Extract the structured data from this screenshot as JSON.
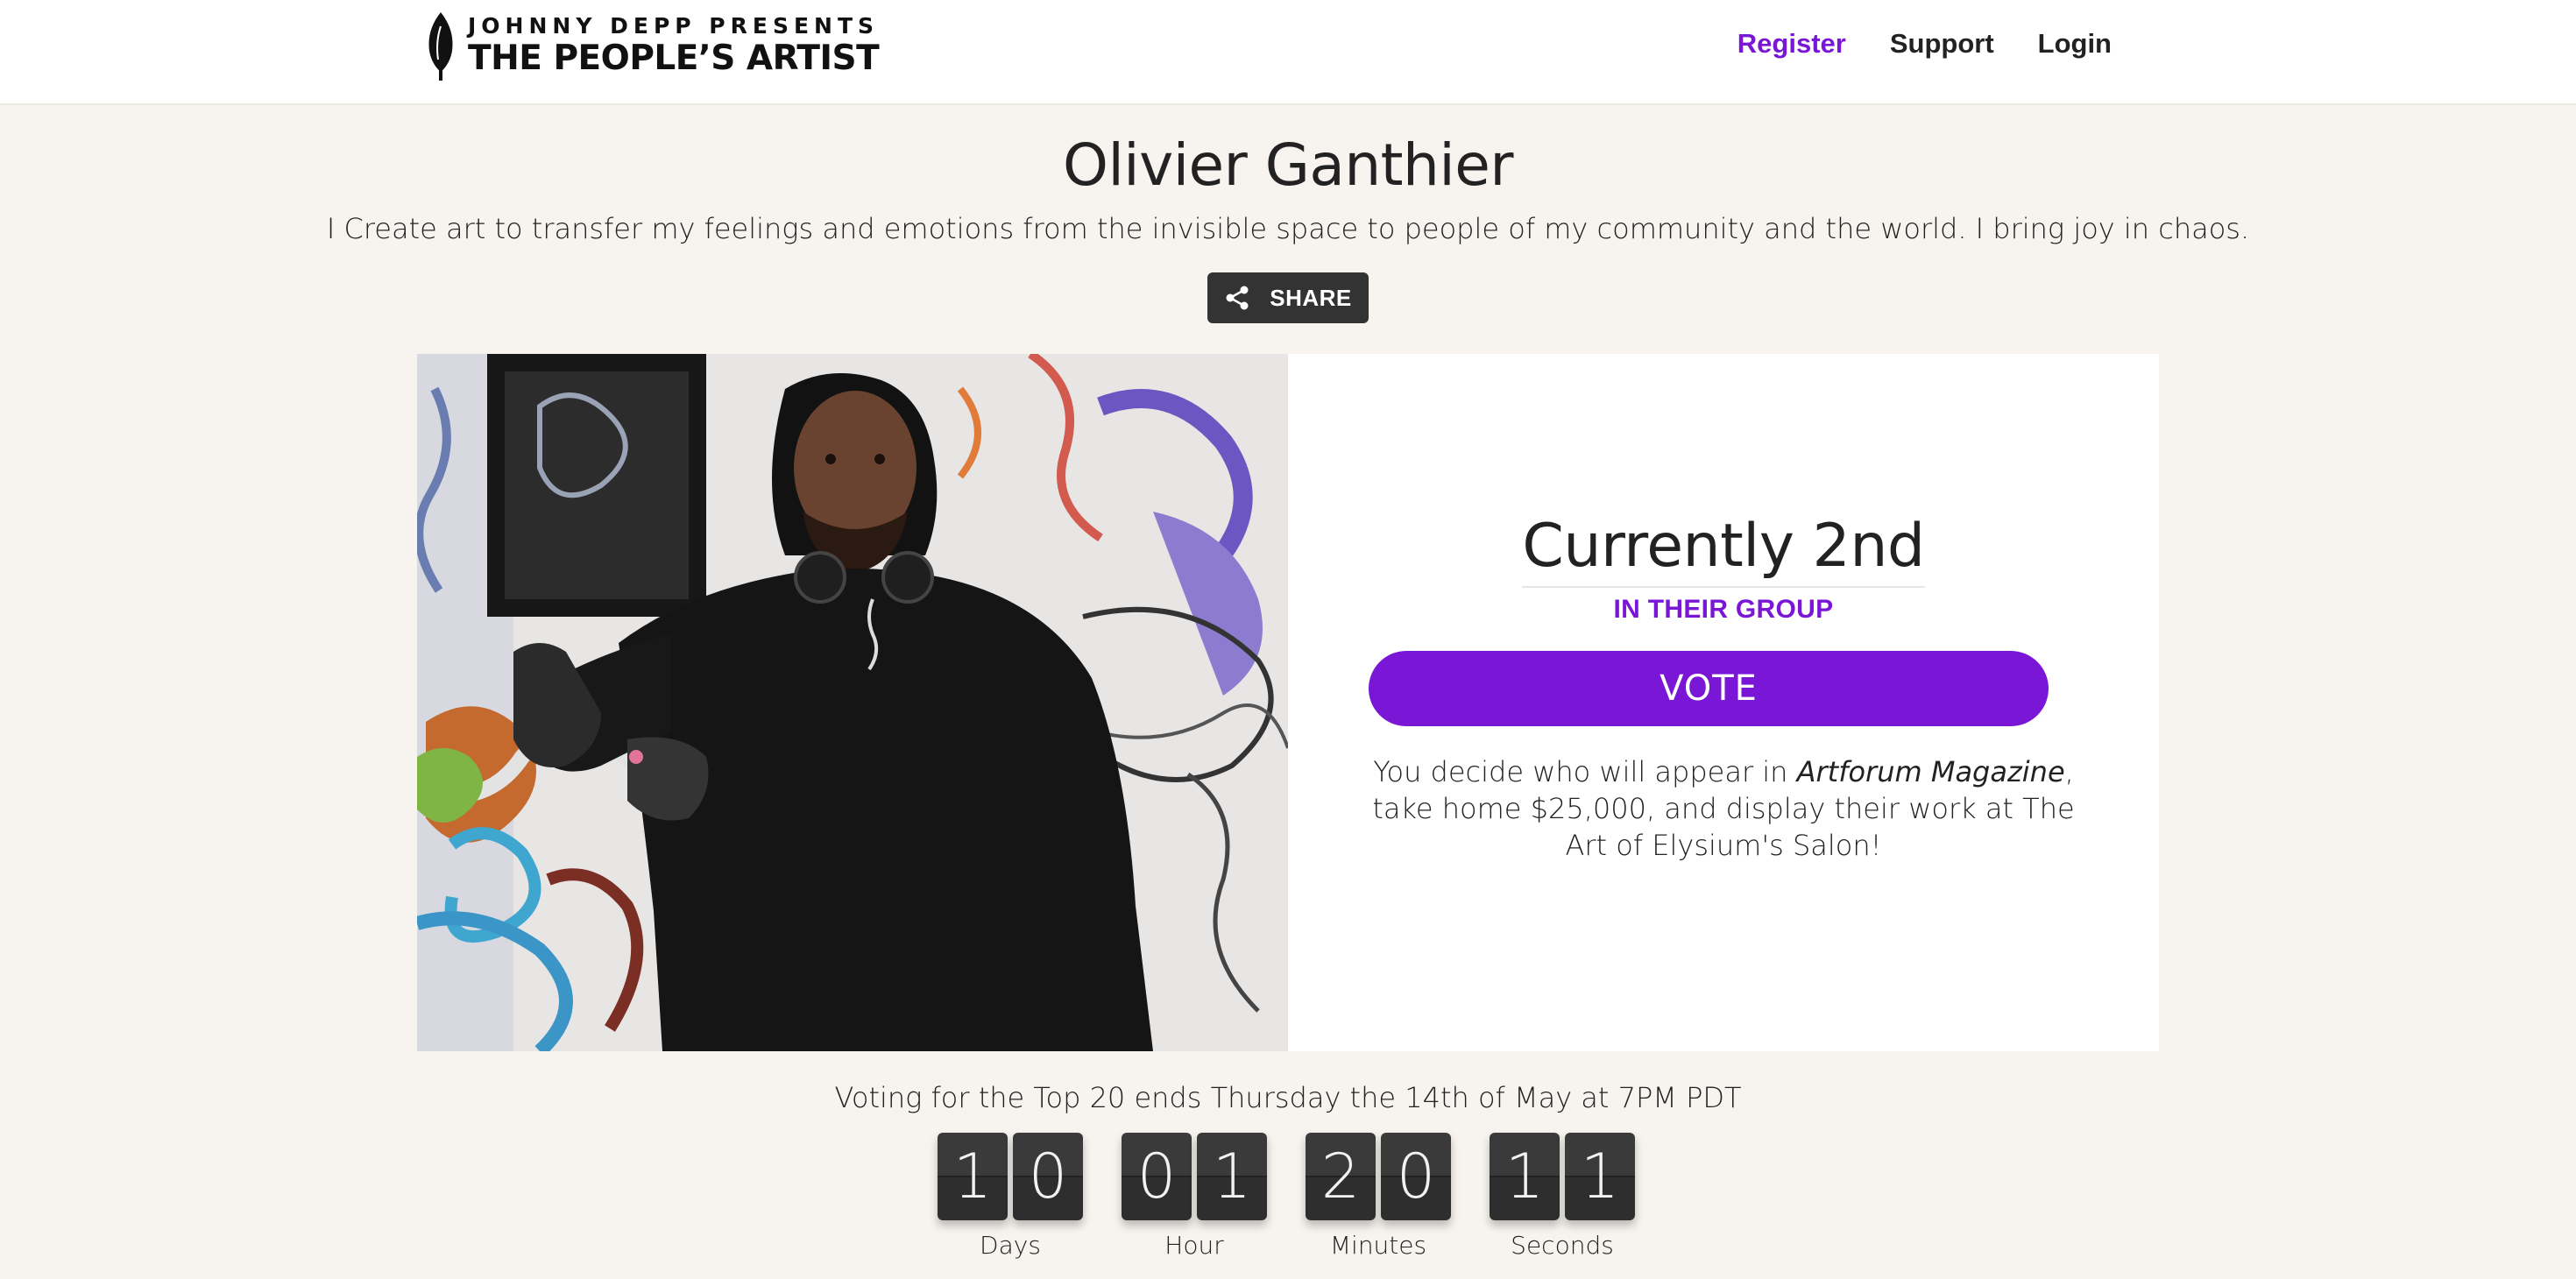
{
  "header": {
    "logo_line1": "JOHNNY DEPP PRESENTS",
    "logo_line2_a": "THE PEOPLE’S",
    "logo_line2_b": "ARTIST",
    "nav": [
      {
        "label": "Register"
      },
      {
        "label": "Support"
      },
      {
        "label": "Login"
      }
    ],
    "accent_color": "#7a17d6"
  },
  "profile": {
    "name": "Olivier Ganthier",
    "tagline": "I Create art to transfer my feelings and emotions from the invisible space to people of my community and the world. I bring joy in chaos.",
    "share_label": "SHARE"
  },
  "standing": {
    "rank_text": "Currently 2nd",
    "group_text": "IN THEIR GROUP",
    "vote_label": "VOTE",
    "copy_before": "You decide who will appear in ",
    "copy_italic": "Artforum Magazine",
    "copy_after": ", take home $25,000, and display their work at The Art of Elysium's Salon!"
  },
  "countdown": {
    "headline": "Voting for the Top 20 ends Thursday the 14th of May at 7PM PDT",
    "units": [
      {
        "label": "Days",
        "d1": "1",
        "d2": "0"
      },
      {
        "label": "Hour",
        "d1": "0",
        "d2": "1"
      },
      {
        "label": "Minutes",
        "d1": "2",
        "d2": "0"
      },
      {
        "label": "Seconds",
        "d1": "1",
        "d2": "1"
      }
    ]
  }
}
